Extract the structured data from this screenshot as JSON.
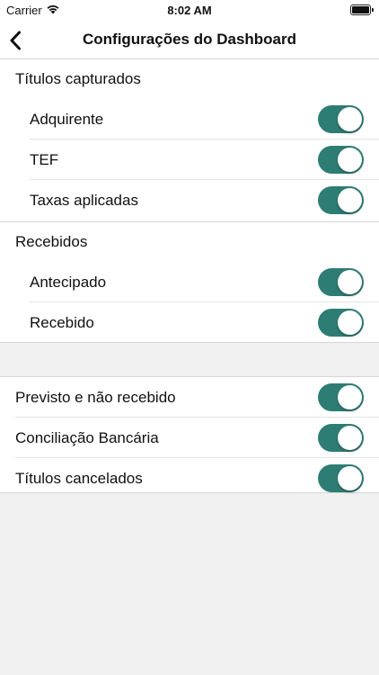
{
  "status_bar": {
    "carrier": "Carrier",
    "time": "8:02 AM"
  },
  "nav": {
    "title": "Configurações do Dashboard",
    "back_icon": "chevron-left-icon"
  },
  "colors": {
    "toggle_on": "#2e7d74"
  },
  "sections": {
    "captured": {
      "header": "Títulos capturados",
      "items": [
        {
          "label": "Adquirente",
          "on": true
        },
        {
          "label": "TEF",
          "on": true
        },
        {
          "label": "Taxas aplicadas",
          "on": true
        }
      ]
    },
    "received": {
      "header": "Recebidos",
      "items": [
        {
          "label": "Antecipado",
          "on": true
        },
        {
          "label": "Recebido",
          "on": true
        }
      ]
    },
    "other": {
      "items": [
        {
          "label": "Previsto e não recebido",
          "on": true
        },
        {
          "label": "Conciliação Bancária",
          "on": true
        },
        {
          "label": "Títulos cancelados",
          "on": true
        }
      ]
    }
  }
}
